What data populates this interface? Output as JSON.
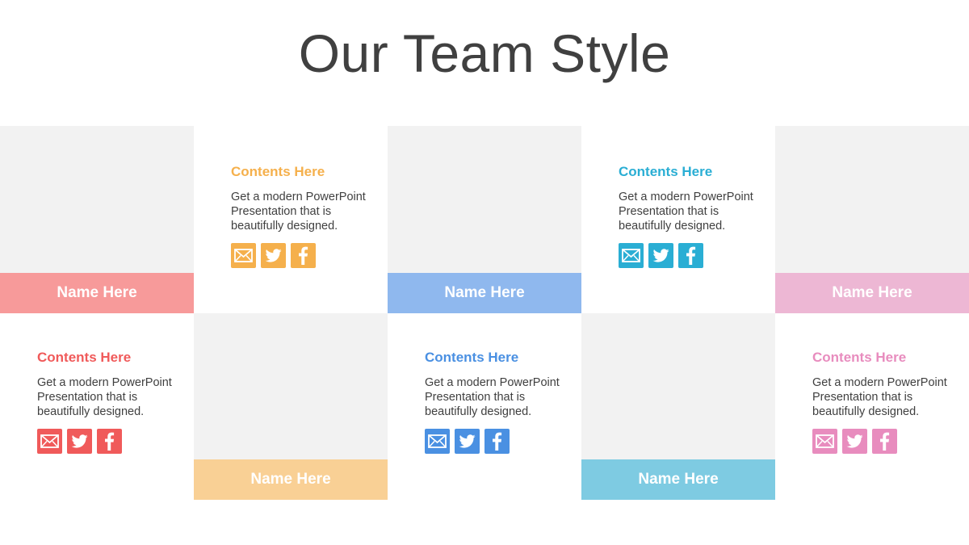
{
  "title": "Our Team Style",
  "colors": {
    "photo_placeholder": "#f2f2f2",
    "title_text": "#404040",
    "body_text": "#404040"
  },
  "members": [
    {
      "name": "Name Here",
      "heading": "Contents Here",
      "text": "Get a modern PowerPoint Presentation that is beautifully designed.",
      "bar_color": "#f79a9a",
      "accent_color": "#f05a5a",
      "icons": [
        "mail-icon",
        "twitter-icon",
        "facebook-icon"
      ]
    },
    {
      "name": "Name Here",
      "heading": "Contents Here",
      "text": "Get a modern PowerPoint Presentation that is beautifully designed.",
      "bar_color": "#f9d095",
      "accent_color": "#f5b04c",
      "icons": [
        "mail-icon",
        "twitter-icon",
        "facebook-icon"
      ]
    },
    {
      "name": "Name Here",
      "heading": "Contents Here",
      "text": "Get a modern PowerPoint Presentation that is beautifully designed.",
      "bar_color": "#8fb8ee",
      "accent_color": "#4a90e2",
      "icons": [
        "mail-icon",
        "twitter-icon",
        "facebook-icon"
      ]
    },
    {
      "name": "Name Here",
      "heading": "Contents Here",
      "text": "Get a modern PowerPoint Presentation that is beautifully designed.",
      "bar_color": "#7ecbe2",
      "accent_color": "#2aaed4",
      "icons": [
        "mail-icon",
        "twitter-icon",
        "facebook-icon"
      ]
    },
    {
      "name": "Name Here",
      "heading": "Contents Here",
      "text": "Get a modern PowerPoint Presentation that is beautifully designed.",
      "bar_color": "#edb7d4",
      "accent_color": "#e88cbe",
      "icons": [
        "mail-icon",
        "twitter-icon",
        "facebook-icon"
      ]
    }
  ]
}
